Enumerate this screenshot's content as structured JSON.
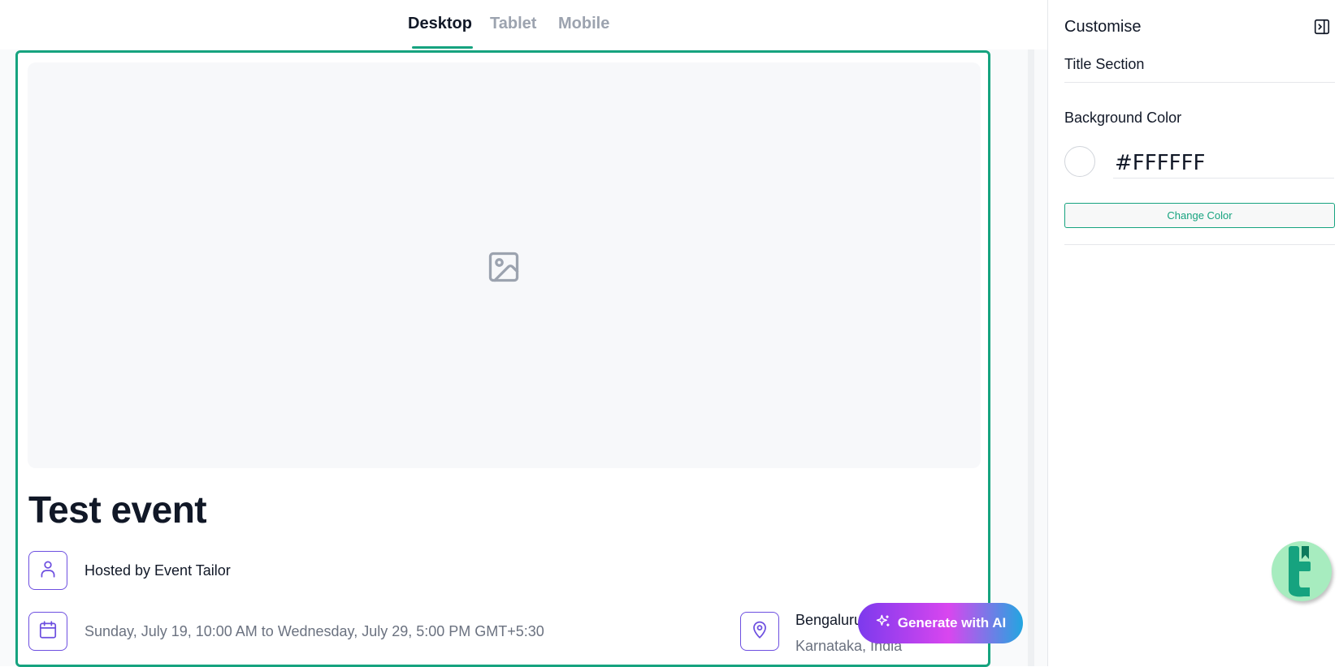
{
  "tabs": [
    {
      "label": "Desktop",
      "active": true
    },
    {
      "label": "Tablet",
      "active": false
    },
    {
      "label": "Mobile",
      "active": false
    }
  ],
  "event": {
    "title": "Test event",
    "host": "Hosted by Event Tailor",
    "datetime": "Sunday, July 19, 10:00 AM to Wednesday, July 29, 5:00 PM GMT+5:30",
    "location_city": "Bengaluru",
    "location_region": "Karnataka, India"
  },
  "generate_button": {
    "label": "Generate with AI"
  },
  "panel": {
    "title": "Customise",
    "section": "Title Section",
    "background_label": "Background Color",
    "color_value": "#FFFFFF",
    "change_label": "Change Color"
  },
  "colors": {
    "accent": "#16a37f",
    "icon_purple": "#6d4fe0",
    "badge_green": "#a7ecbf",
    "gradient_start": "#7c3aed",
    "gradient_end": "#22a6e0"
  },
  "icons": [
    "image-placeholder-icon",
    "user-icon",
    "calendar-icon",
    "map-pin-icon",
    "sparkle-icon",
    "panel-collapse-icon",
    "brand-logo-icon"
  ]
}
